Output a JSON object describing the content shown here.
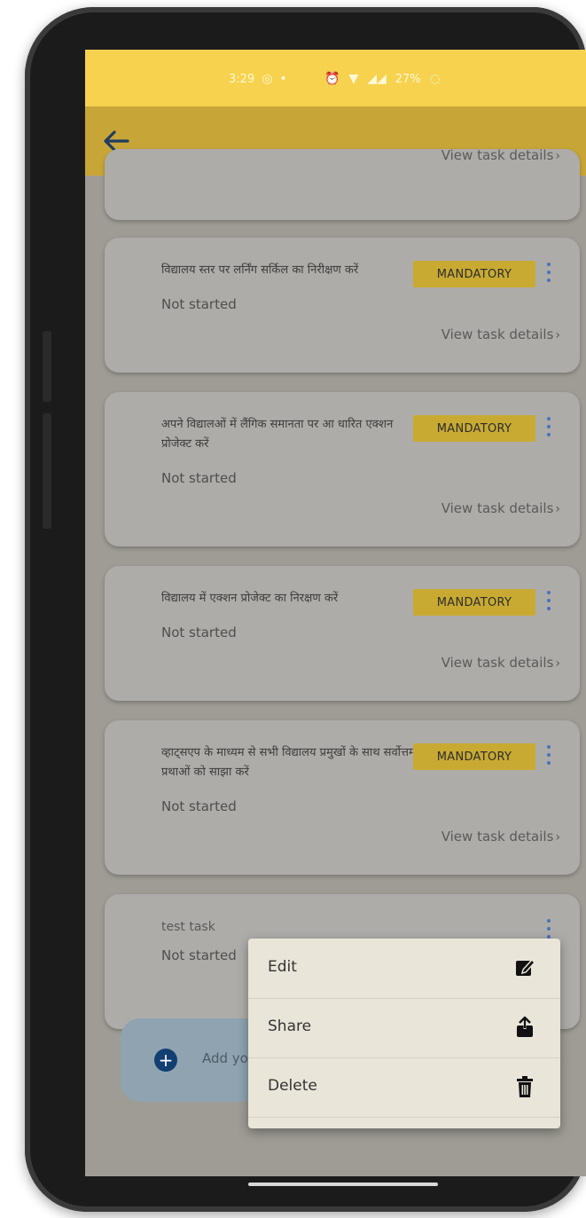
{
  "status_bar": {
    "time": "3:29",
    "battery": "27%"
  },
  "tasks": [
    {
      "title": "",
      "status": "",
      "view_label": "View task details",
      "chevron": "›"
    },
    {
      "title": "विद्यालय स्तर पर लर्निंग सर्किल का निरीक्षण करें",
      "badge": "MANDATORY",
      "status": "Not started",
      "view_label": "View task details",
      "chevron": "›"
    },
    {
      "title": "अपने विद्यालओं में लैंगिक समानता पर आ धारित एक्शन प्रोजेक्ट करें",
      "badge": "MANDATORY",
      "status": "Not started",
      "view_label": "View task details",
      "chevron": "›"
    },
    {
      "title": "विद्यालय में एक्शन प्रोजेक्ट का निरक्षण करें",
      "badge": "MANDATORY",
      "status": "Not started",
      "view_label": "View task details",
      "chevron": "›"
    },
    {
      "title": "व्हाट्सएप के माध्यम से सभी विद्यालय प्रमुखों के साथ सर्वोत्तम प्रथाओं को साझा करें",
      "badge": "MANDATORY",
      "status": "Not started",
      "view_label": "View task details",
      "chevron": "›"
    },
    {
      "title": "test task",
      "status": "Not started"
    }
  ],
  "add_task": {
    "plus": "+",
    "label": "Add your"
  },
  "context_menu": {
    "items": [
      {
        "label": "Edit",
        "icon": "edit-icon"
      },
      {
        "label": "Share",
        "icon": "share-icon"
      },
      {
        "label": "Delete",
        "icon": "delete-icon"
      }
    ]
  },
  "colors": {
    "status_bar": "#f7d24e",
    "app_bar": "#c7a637",
    "badge": "#c8aa33",
    "kebab": "#4a72b8",
    "add_circle": "#123e72"
  }
}
